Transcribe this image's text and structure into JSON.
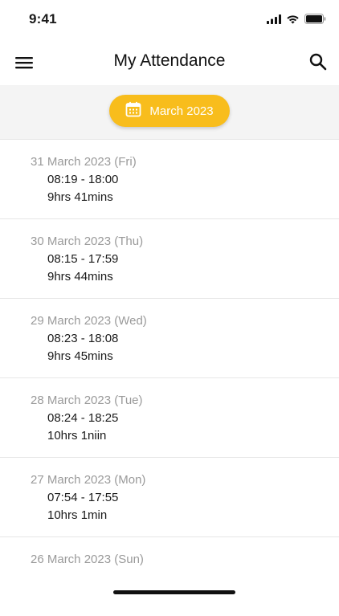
{
  "status_bar": {
    "time": "9:41"
  },
  "header": {
    "title": "My Attendance",
    "menu_icon": "hamburger-menu-icon",
    "search_icon": "search-icon"
  },
  "month_selector": {
    "label": "March 2023",
    "icon": "calendar-icon",
    "color": "#f8bd1c"
  },
  "attendance": [
    {
      "date": "31 March 2023 (Fri)",
      "time": "08:19 - 18:00",
      "duration": "9hrs 41mins"
    },
    {
      "date": "30 March 2023 (Thu)",
      "time": "08:15 - 17:59",
      "duration": "9hrs 44mins"
    },
    {
      "date": "29 March 2023 (Wed)",
      "time": "08:23 - 18:08",
      "duration": "9hrs 45mins"
    },
    {
      "date": "28 March 2023 (Tue)",
      "time": "08:24 - 18:25",
      "duration": "10hrs 1niin"
    },
    {
      "date": "27 March 2023 (Mon)",
      "time": "07:54 - 17:55",
      "duration": "10hrs 1min"
    },
    {
      "date": "26 March 2023 (Sun)"
    }
  ]
}
